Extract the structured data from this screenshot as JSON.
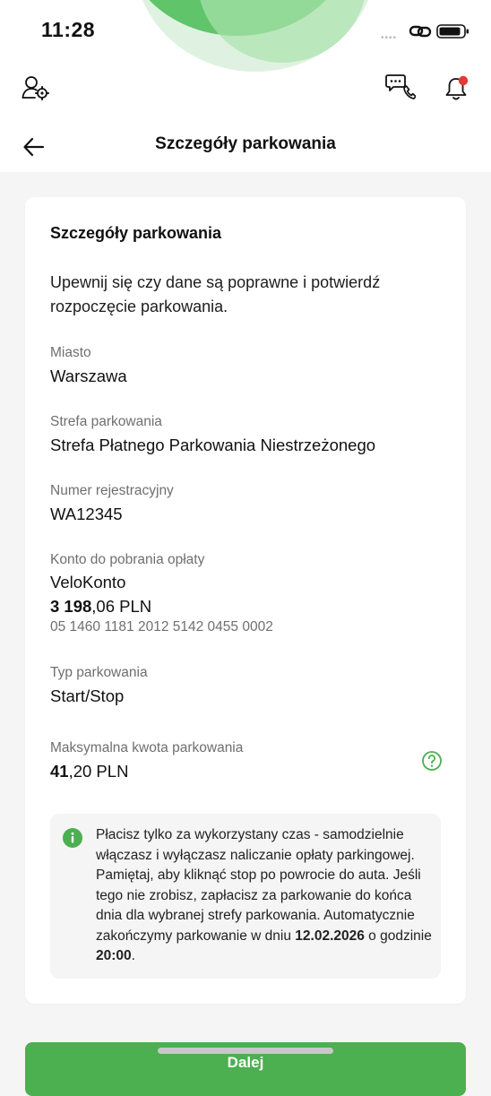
{
  "status_bar": {
    "time": "11:28",
    "signal": "•••• "
  },
  "header": {
    "title": "Szczegóły parkowania"
  },
  "card": {
    "title": "Szczegóły parkowania",
    "intro": "Upewnij się czy dane są poprawne i potwierdź rozpoczęcie parkowania.",
    "city": {
      "label": "Miasto",
      "value": "Warszawa"
    },
    "zone": {
      "label": "Strefa parkowania",
      "value": "Strefa Płatnego Parkowania Niestrzeżonego"
    },
    "plate": {
      "label": "Numer rejestracyjny",
      "value": "WA12345"
    },
    "account": {
      "label": "Konto do pobrania opłaty",
      "name": "VeloKonto",
      "balance_int": "3 198",
      "balance_rest": ",06 PLN",
      "number": "05 1460 1181 2012 5142 0455 0002"
    },
    "type": {
      "label": "Typ parkowania",
      "value": "Start/Stop"
    },
    "max": {
      "label": "Maksymalna kwota parkowania",
      "value_int": "41",
      "value_rest": ",20 PLN"
    },
    "info": {
      "text_before": "Płacisz tylko za wykorzystany czas - samodzielnie włączasz i wyłączasz naliczanie opłaty parkingowej. Pamiętaj, aby kliknąć stop po powrocie do auta. Jeśli tego nie zrobisz, zapłacisz za parkowanie do końca dnia dla wybranej strefy parkowania. Automatycznie zakończymy parkowanie w dniu ",
      "date": "12.02.2026",
      "text_middle": " o godzinie ",
      "hour": "20:00",
      "text_after": "."
    }
  },
  "cta": {
    "label": "Dalej"
  },
  "colors": {
    "accent": "#4caf50",
    "notification_dot": "#e53935"
  },
  "icons": [
    "user-settings-icon",
    "chat-phone-icon",
    "bell-icon",
    "back-arrow-icon",
    "help-icon",
    "info-icon",
    "link-icon",
    "battery-icon"
  ]
}
